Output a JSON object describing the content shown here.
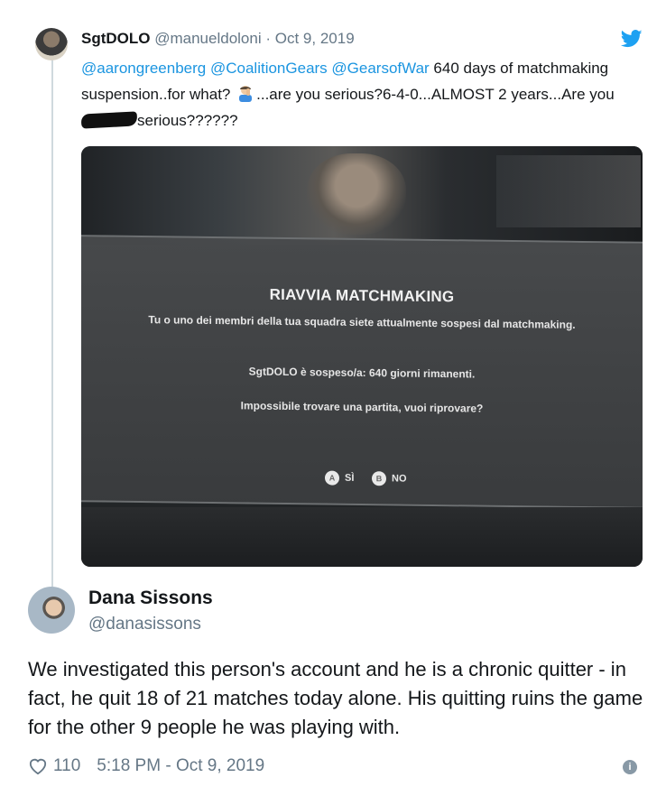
{
  "quoted_tweet": {
    "name": "SgtDOLO",
    "handle": "@manueldoloni",
    "separator": "·",
    "date": "Oct 9, 2019",
    "mention1": "@aarongreenberg",
    "mention2": "@CoalitionGears",
    "mention3": "@GearsofWar",
    "text_a": " 640 days of matchmaking suspension..for what?",
    "text_b": "...are you serious?6-4-0...ALMOST 2 years...Are you ",
    "text_c": "serious??????"
  },
  "photo": {
    "dialog_title": "RIAVVIA MATCHMAKING",
    "dialog_line1": "Tu o uno dei membri della tua squadra siete attualmente sospesi dal matchmaking.",
    "dialog_line2": "SgtDOLO è sospeso/a: 640 giorni rimanenti.",
    "dialog_line3": "Impossibile trovare una partita, vuoi riprovare?",
    "option_yes_btn": "A",
    "option_yes": "SÌ",
    "option_no_btn": "B",
    "option_no": "NO"
  },
  "reply": {
    "name": "Dana Sissons",
    "handle": "@danasissons",
    "text": "We investigated this person's account and he is a chronic quitter - in fact, he quit 18 of 21 matches today alone. His quitting ruins the game for the other 9 people he was playing with.",
    "likes": "110",
    "timestamp": "5:18 PM - Oct 9, 2019"
  },
  "colors": {
    "link": "#1b95e0",
    "muted": "#657786",
    "text": "#14171a"
  },
  "icons": {
    "brand": "twitter-bird-icon",
    "like": "heart-icon",
    "info": "info-icon",
    "emoji": "facepalm-emoji-icon"
  }
}
